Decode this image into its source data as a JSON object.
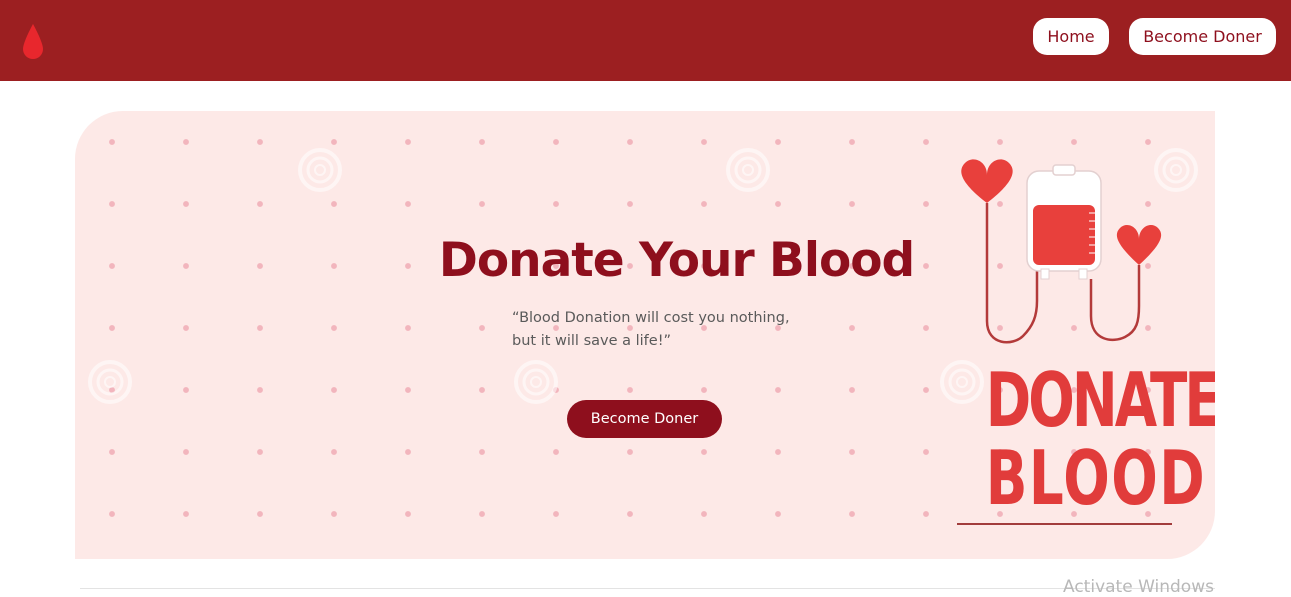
{
  "navbar": {
    "logo_icon": "blood-drop-icon",
    "links": [
      {
        "label": "Home"
      },
      {
        "label": "Become Doner"
      }
    ]
  },
  "hero": {
    "title": "Donate Your Blood",
    "quote_line1": "“Blood Donation will cost you nothing,",
    "quote_line2": "but it will save a life!”",
    "cta_label": "Become Doner",
    "illustration": {
      "icon": "blood-bag-hearts-icon",
      "text_line1": "DONATE",
      "text_line2": "BLOOD"
    }
  },
  "system": {
    "watermark": "Activate Windows"
  },
  "colors": {
    "navbar_bg": "#9c1f21",
    "primary": "#8e0f1d",
    "hero_bg": "#fde9e7",
    "illustration_red": "#e13c3b"
  }
}
